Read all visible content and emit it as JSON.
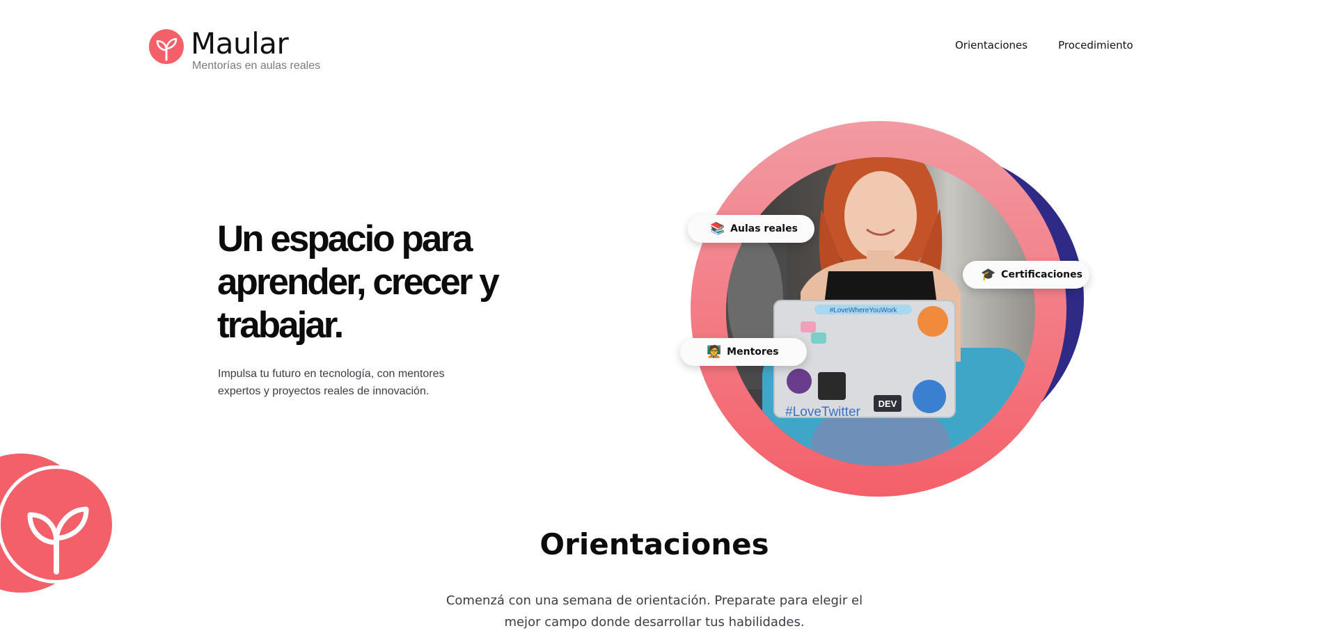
{
  "brand": {
    "name": "Maular",
    "tagline": "Mentorías en aulas reales",
    "color": "#f4606a"
  },
  "nav": {
    "items": [
      {
        "label": "Orientaciones"
      },
      {
        "label": "Procedimiento"
      }
    ]
  },
  "hero": {
    "title": "Un espacio para aprender, crecer y trabajar.",
    "subtitle": "Impulsa tu futuro en tecnología, con mentores expertos y proyectos reales de innovación.",
    "badges": [
      {
        "label": "Aulas reales",
        "icon": "books-icon"
      },
      {
        "label": "Certificaciones",
        "icon": "graduation-cap-icon"
      },
      {
        "label": "Mentores",
        "icon": "teacher-icon"
      }
    ],
    "laptop_stickers": {
      "hashtag_top": "#LoveWhereYouWork",
      "hashtag_bottom": "#LoveTwitter",
      "dev": "DEV"
    },
    "colors": {
      "pink_light": "#f29aa2",
      "pink": "#f4606a",
      "navy": "#2e2a86"
    }
  },
  "section": {
    "title": "Orientaciones",
    "subtitle": "Comenzá con una semana de orientación. Preparate para elegir el mejor campo donde desarrollar tus habilidades."
  }
}
